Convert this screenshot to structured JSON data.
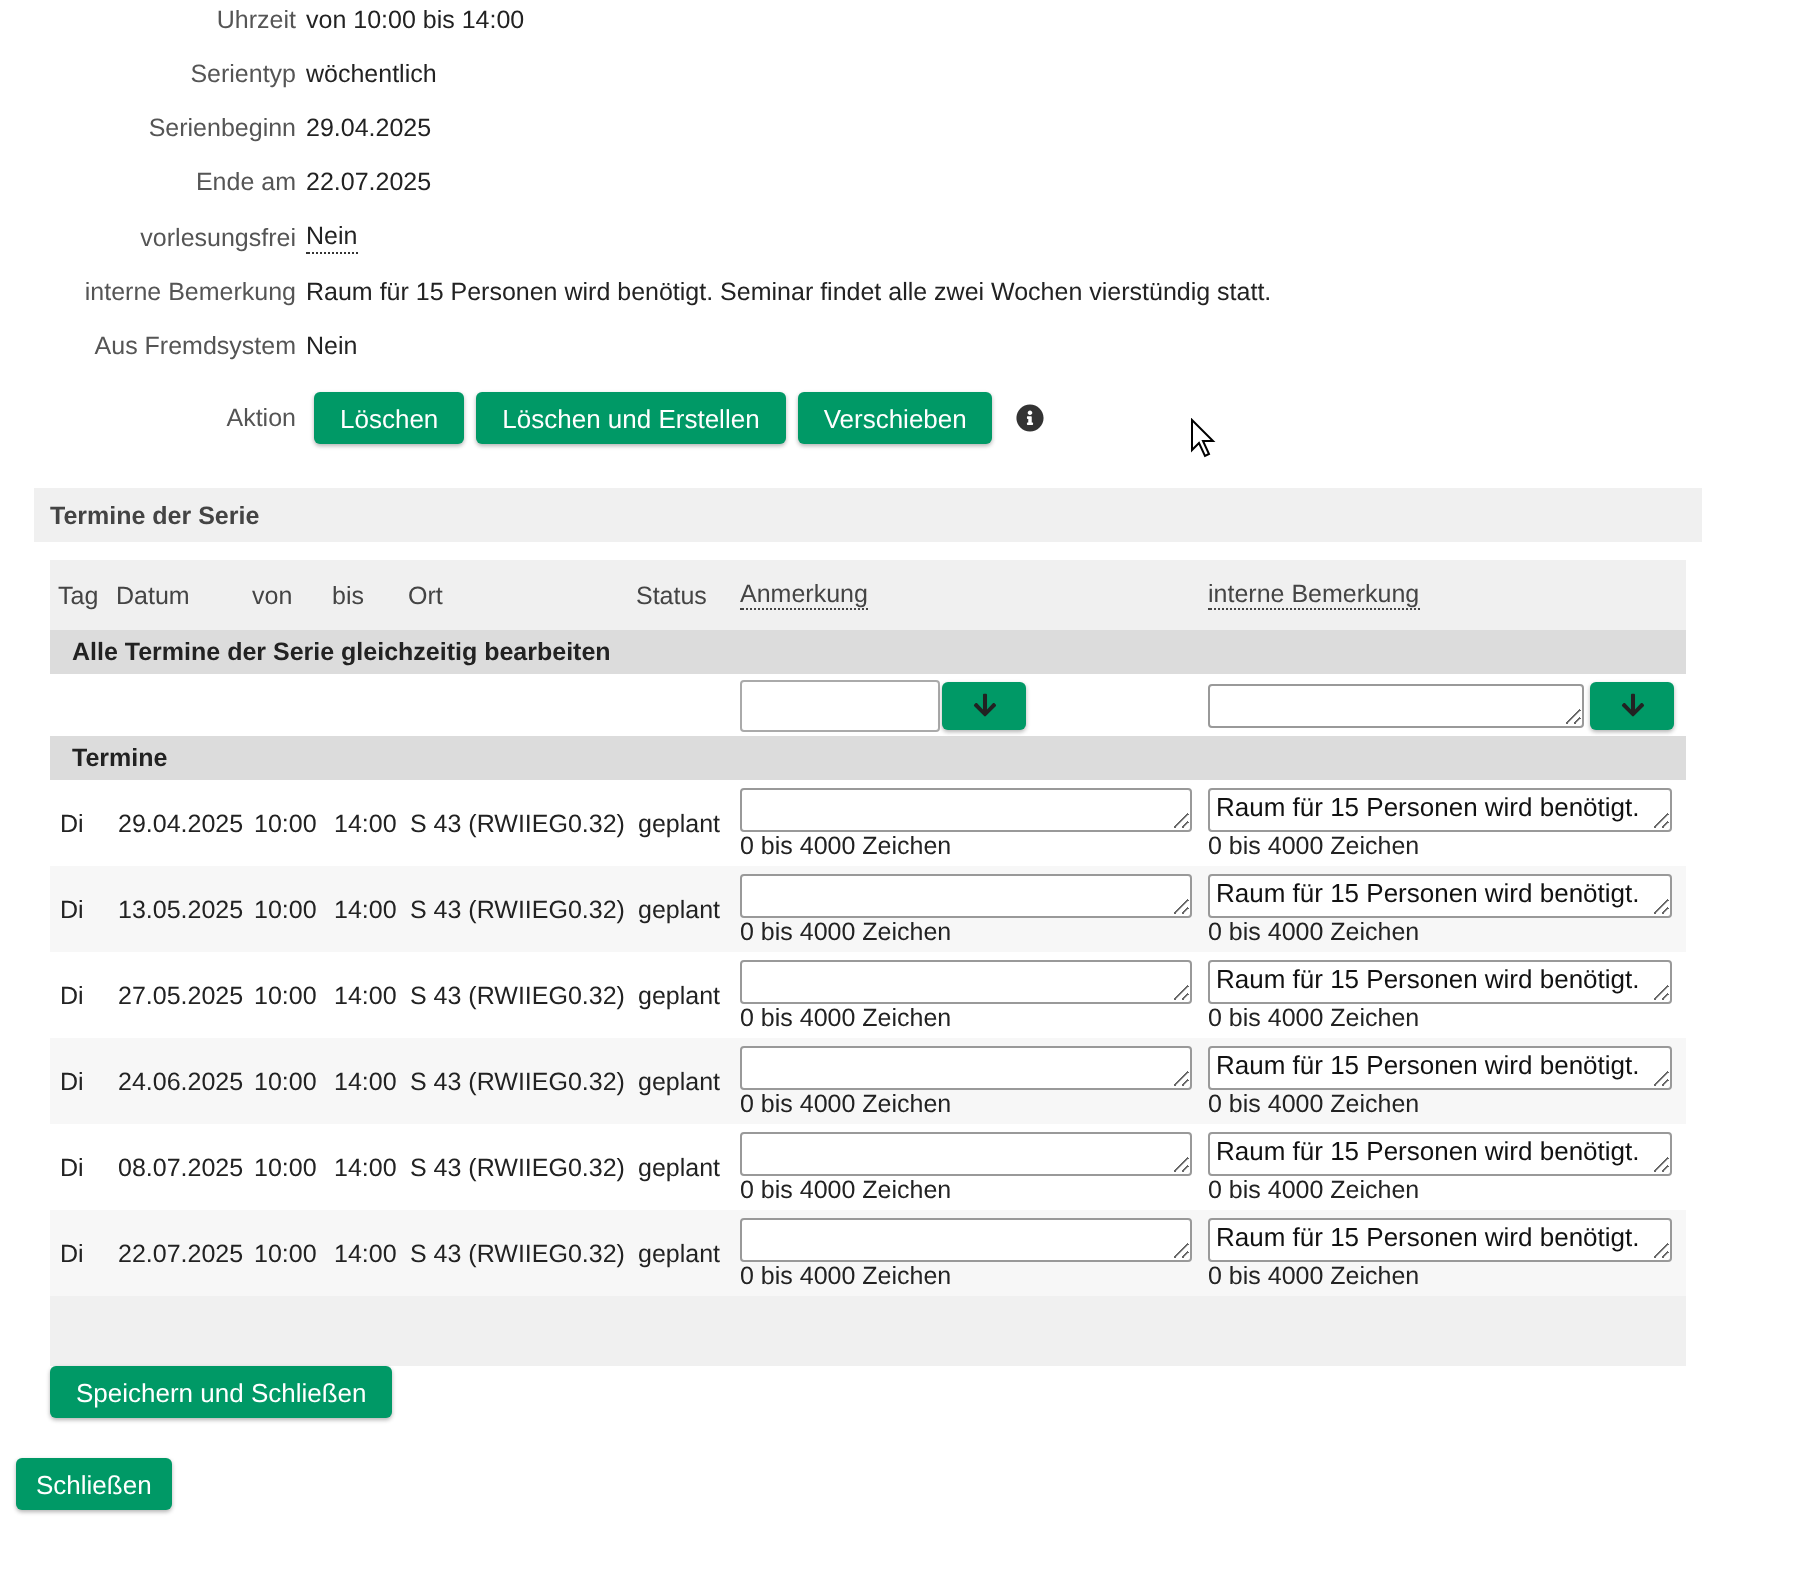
{
  "details": [
    {
      "label": "Uhrzeit",
      "value": "von 10:00 bis 14:00",
      "tooltip": false
    },
    {
      "label": "Serientyp",
      "value": "wöchentlich",
      "tooltip": false
    },
    {
      "label": "Serienbeginn",
      "value": "29.04.2025",
      "tooltip": false
    },
    {
      "label": "Ende am",
      "value": "22.07.2025",
      "tooltip": false
    },
    {
      "label": "vorlesungsfrei",
      "value": "Nein",
      "tooltip": true
    },
    {
      "label": "interne Bemerkung",
      "value": "Raum für 15 Personen wird benötigt. Seminar findet alle zwei Wochen vierstündig statt.",
      "tooltip": false
    },
    {
      "label": "Aus Fremdsystem",
      "value": "Nein",
      "tooltip": false
    }
  ],
  "actions": {
    "label": "Aktion",
    "buttons": [
      "Löschen",
      "Löschen und Erstellen",
      "Verschieben"
    ]
  },
  "series": {
    "title": "Termine der Serie",
    "columns": [
      {
        "label": "Tag",
        "tooltip": false
      },
      {
        "label": "Datum",
        "tooltip": false
      },
      {
        "label": "von",
        "tooltip": false
      },
      {
        "label": "bis",
        "tooltip": false
      },
      {
        "label": "Ort",
        "tooltip": false
      },
      {
        "label": "Status",
        "tooltip": false
      },
      {
        "label": "Anmerkung",
        "tooltip": true
      },
      {
        "label": "interne Bemerkung",
        "tooltip": true
      }
    ],
    "bulk_edit_title": "Alle Termine der Serie gleichzeitig bearbeiten",
    "group_title": "Termine",
    "rows": [
      {
        "tag": "Di",
        "datum": "29.04.2025",
        "von": "10:00",
        "bis": "14:00",
        "ort": "S 43 (RWIIEG0.32)",
        "status": "geplant",
        "anmerkung_hint": "0 bis 4000 Zeichen",
        "interne_bemerkung": "Raum für 15 Personen wird benötigt.",
        "interne_hint": "0 bis 4000 Zeichen"
      },
      {
        "tag": "Di",
        "datum": "13.05.2025",
        "von": "10:00",
        "bis": "14:00",
        "ort": "S 43 (RWIIEG0.32)",
        "status": "geplant",
        "anmerkung_hint": "0 bis 4000 Zeichen",
        "interne_bemerkung": "Raum für 15 Personen wird benötigt.",
        "interne_hint": "0 bis 4000 Zeichen"
      },
      {
        "tag": "Di",
        "datum": "27.05.2025",
        "von": "10:00",
        "bis": "14:00",
        "ort": "S 43 (RWIIEG0.32)",
        "status": "geplant",
        "anmerkung_hint": "0 bis 4000 Zeichen",
        "interne_bemerkung": "Raum für 15 Personen wird benötigt.",
        "interne_hint": "0 bis 4000 Zeichen"
      },
      {
        "tag": "Di",
        "datum": "24.06.2025",
        "von": "10:00",
        "bis": "14:00",
        "ort": "S 43 (RWIIEG0.32)",
        "status": "geplant",
        "anmerkung_hint": "0 bis 4000 Zeichen",
        "interne_bemerkung": "Raum für 15 Personen wird benötigt.",
        "interne_hint": "0 bis 4000 Zeichen"
      },
      {
        "tag": "Di",
        "datum": "08.07.2025",
        "von": "10:00",
        "bis": "14:00",
        "ort": "S 43 (RWIIEG0.32)",
        "status": "geplant",
        "anmerkung_hint": "0 bis 4000 Zeichen",
        "interne_bemerkung": "Raum für 15 Personen wird benötigt.",
        "interne_hint": "0 bis 4000 Zeichen"
      },
      {
        "tag": "Di",
        "datum": "22.07.2025",
        "von": "10:00",
        "bis": "14:00",
        "ort": "S 43 (RWIIEG0.32)",
        "status": "geplant",
        "anmerkung_hint": "0 bis 4000 Zeichen",
        "interne_bemerkung": "Raum für 15 Personen wird benötigt.",
        "interne_hint": "0 bis 4000 Zeichen"
      }
    ]
  },
  "save_button": "Speichern und Schließen",
  "close_button": "Schließen"
}
